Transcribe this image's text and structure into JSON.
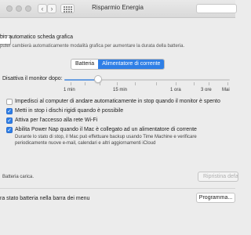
{
  "window": {
    "title": "Risparmio Energia"
  },
  "graphics": {
    "title": "bio automatico scheda grafica",
    "description": "puter cambierà automaticamente modalità grafica per aumentare la durata della batteria."
  },
  "tabs": [
    {
      "label": "Batteria",
      "active": false
    },
    {
      "label": "Alimentatore di corrente",
      "active": true
    }
  ],
  "display_sleep": {
    "label": "Disattiva il monitor dopo:",
    "value": "3 min",
    "ticks": [
      "1 min",
      "15 min",
      "1 ora",
      "3 ore",
      "Mai"
    ]
  },
  "options": [
    {
      "label": "Impedisci al computer di andare automaticamente in stop quando il monitor è spento",
      "checked": false
    },
    {
      "label": "Metti in stop i dischi rigidi quando è possibile",
      "checked": true
    },
    {
      "label": "Attiva per l'accesso alla rete Wi-Fi",
      "checked": true
    },
    {
      "label": "Abilita Power Nap quando il Mac è collegato ad un alimentatore di corrente",
      "checked": true,
      "description_line1": "Durante lo stato di stop, il Mac può effettuare backup usando Time Machine e verificare",
      "description_line2": "periodicamente nuove e-mail, calendari e altri aggiornamenti iCloud"
    }
  ],
  "status": {
    "text": "Batteria carica."
  },
  "buttons": {
    "restore": "Ripristina defa",
    "schedule": "Programma..."
  },
  "menu_bar_option": {
    "label": "ra stato batteria nella barra dei menu"
  },
  "colors": {
    "accent": "#2f7fe6",
    "window_bg": "#ececec"
  }
}
